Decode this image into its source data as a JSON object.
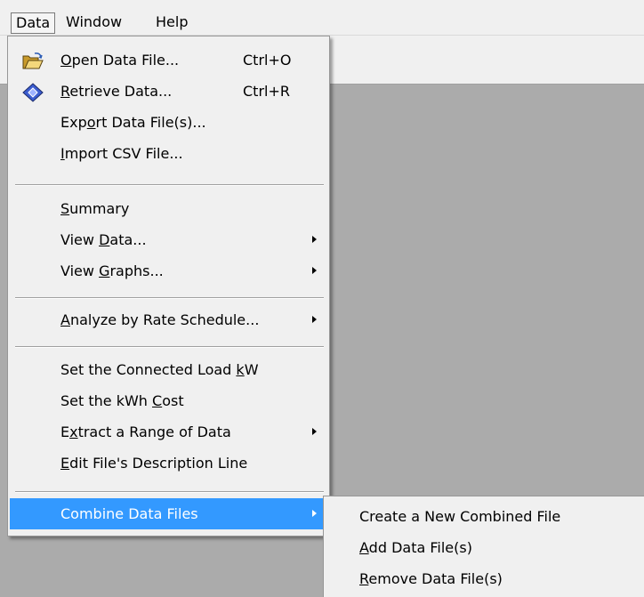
{
  "menubar": {
    "items": [
      {
        "label": "Data"
      },
      {
        "label": "Window"
      },
      {
        "label": "Help"
      }
    ]
  },
  "data_menu": {
    "items": [
      {
        "icon": "open-folder-icon",
        "label_pre": "",
        "mnemonic": "O",
        "label_post": "pen Data File...",
        "shortcut": "Ctrl+O"
      },
      {
        "icon": "retrieve-data-icon",
        "label_pre": "",
        "mnemonic": "R",
        "label_post": "etrieve Data...",
        "shortcut": "Ctrl+R"
      },
      {
        "label_pre": "Exp",
        "mnemonic": "o",
        "label_post": "rt Data File(s)..."
      },
      {
        "label_pre": "",
        "mnemonic": "I",
        "label_post": "mport CSV File..."
      },
      {
        "label_pre": "",
        "mnemonic": "S",
        "label_post": "ummary"
      },
      {
        "label_pre": "View ",
        "mnemonic": "D",
        "label_post": "ata...",
        "submenu": true
      },
      {
        "label_pre": "View ",
        "mnemonic": "G",
        "label_post": "raphs...",
        "submenu": true
      },
      {
        "label_pre": "",
        "mnemonic": "A",
        "label_post": "nalyze by Rate Schedule...",
        "submenu": true
      },
      {
        "label_pre": "Set the Connected Load ",
        "mnemonic": "k",
        "label_post": "W"
      },
      {
        "label_pre": "Set the kWh ",
        "mnemonic": "C",
        "label_post": "ost"
      },
      {
        "label_pre": "E",
        "mnemonic": "x",
        "label_post": "tract a Range of Data",
        "submenu": true
      },
      {
        "label_pre": "",
        "mnemonic": "E",
        "label_post": "dit File's Description Line"
      },
      {
        "label_pre": "Combine Data Files",
        "mnemonic": "",
        "label_post": "",
        "submenu": true,
        "highlighted": true
      }
    ]
  },
  "combine_submenu": {
    "items": [
      {
        "label_pre": "Create a New Combined File",
        "mnemonic": "",
        "label_post": ""
      },
      {
        "label_pre": "",
        "mnemonic": "A",
        "label_post": "dd Data File(s)"
      },
      {
        "label_pre": "",
        "mnemonic": "R",
        "label_post": "emove Data File(s)"
      }
    ]
  },
  "colors": {
    "highlight": "#3399ff",
    "menu_background": "#f0f0f0",
    "workspace": "#ababab"
  }
}
